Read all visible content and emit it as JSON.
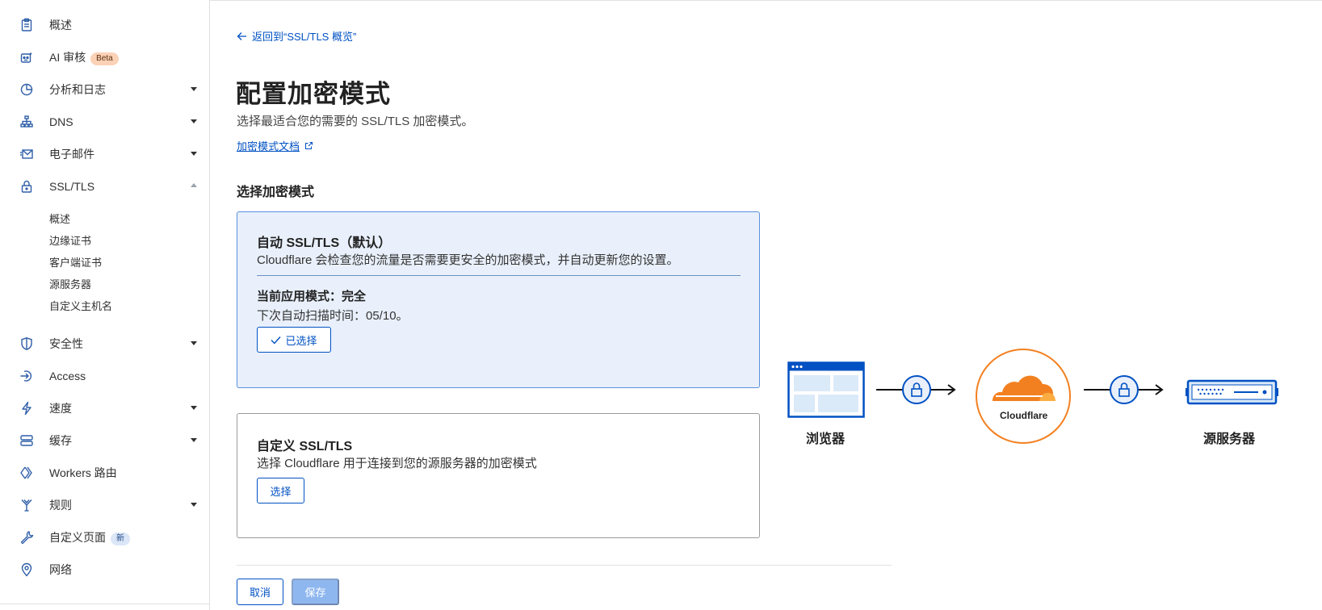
{
  "sidebar": {
    "items": [
      {
        "label": "概述"
      },
      {
        "label": "AI 审核",
        "badge": "Beta"
      },
      {
        "label": "分析和日志"
      },
      {
        "label": "DNS"
      },
      {
        "label": "电子邮件"
      },
      {
        "label": "SSL/TLS"
      },
      {
        "label": "安全性"
      },
      {
        "label": "Access"
      },
      {
        "label": "速度"
      },
      {
        "label": "缓存"
      },
      {
        "label": "Workers 路由"
      },
      {
        "label": "规则"
      },
      {
        "label": "自定义页面",
        "badge": "新"
      },
      {
        "label": "网络"
      }
    ],
    "ssl_sub_items": [
      "概述",
      "边缘证书",
      "客户端证书",
      "源服务器",
      "自定义主机名"
    ]
  },
  "main": {
    "back_link": "返回到“SSL/TLS 概览”",
    "title": "配置加密模式",
    "subtitle": "选择最适合您的需要的 SSL/TLS 加密模式。",
    "doc_link": "加密模式文档",
    "section_heading": "选择加密模式",
    "auto_card": {
      "title": "自动 SSL/TLS（默认）",
      "description": "Cloudflare 会检查您的流量是否需要更安全的加密模式，并自动更新您的设置。",
      "current_mode": "当前应用模式：完全",
      "next_scan": "下次自动扫描时间：05/10。",
      "selected_label": "已选择"
    },
    "custom_card": {
      "title": "自定义 SSL/TLS",
      "description": "选择 Cloudflare 用于连接到您的源服务器的加密模式",
      "select_label": "选择"
    },
    "cancel_label": "取消",
    "save_label": "保存"
  },
  "diagram": {
    "browser_label": "浏览器",
    "cloudflare_label": "Cloudflare",
    "origin_label": "源服务器"
  },
  "colors": {
    "accent": "#0051c3",
    "cloudflare_orange": "#f38020",
    "selected_card_bg": "#e9f0fb"
  }
}
